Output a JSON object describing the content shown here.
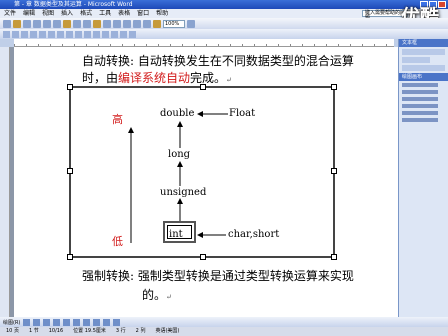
{
  "window": {
    "title": "第 - 章 数据类型及其运算 - Microsoft Word"
  },
  "menu": [
    "文件",
    "编辑",
    "视图",
    "插入",
    "格式",
    "工具",
    "表格",
    "窗口",
    "帮助"
  ],
  "help_box": "键入需要帮助的问题",
  "logo": "优酷",
  "toolbar": {
    "zoom": "100%"
  },
  "document": {
    "para1_line1": "自动转换: 自动转换发生在不同数据类型的混合运算",
    "para1_line2_pre": "时，由",
    "para1_line2_red": "编译系统自动",
    "para1_line2_post": "完成。",
    "para2_line1": "强制转换: 强制类型转换是通过类型转换运算来实现",
    "para2_line2": "的。"
  },
  "diagram": {
    "high": "高",
    "low": "低",
    "double": "double",
    "float": "Float",
    "long": "long",
    "unsigned": "unsigned",
    "int": "int",
    "char_short": "char,short"
  },
  "taskpane": {
    "title": "文本框",
    "title2": "绘图画布"
  },
  "drawbar": {
    "label": "绘图(R)"
  },
  "status": {
    "page": "10 页",
    "section": "1 节",
    "pages": "10/16",
    "position": "位置 19.5厘米",
    "line": "3 行",
    "col": "2 列",
    "lang": "英语(美国)"
  }
}
